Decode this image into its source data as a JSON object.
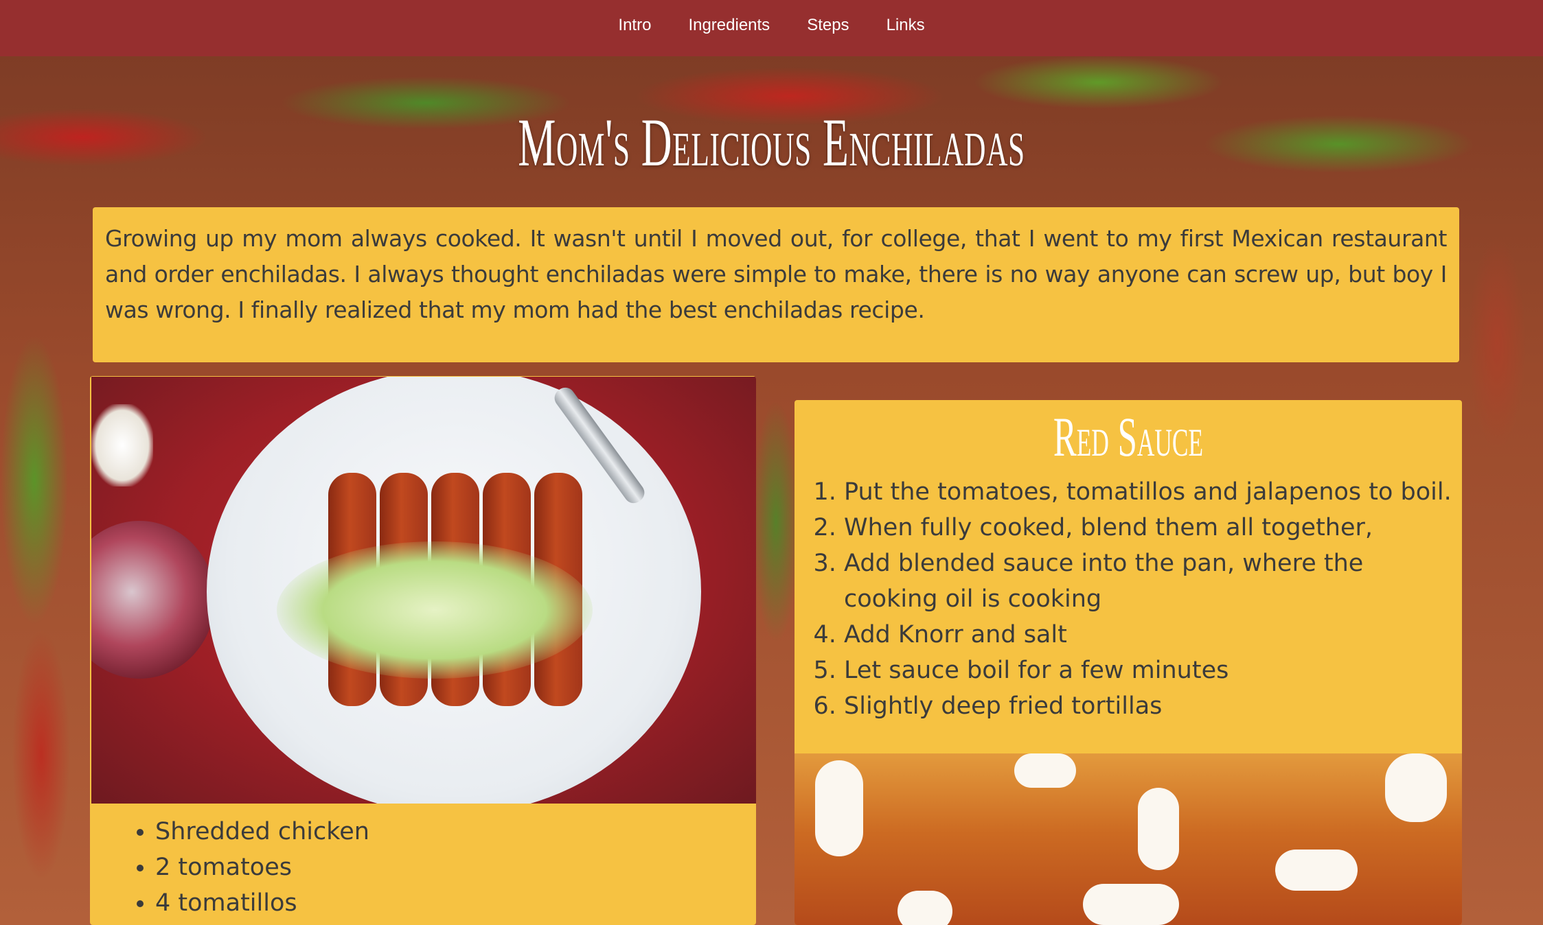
{
  "nav": {
    "items": [
      {
        "label": "Intro"
      },
      {
        "label": "Ingredients"
      },
      {
        "label": "Steps"
      },
      {
        "label": "Links"
      }
    ]
  },
  "page": {
    "title": "Mom's Delicious Enchiladas"
  },
  "intro": {
    "text": "Growing up my mom always cooked. It wasn't until I moved out, for college, that I went to my first Mexican restaurant and order enchiladas. I always thought enchiladas were simple to make, there is no way anyone can screw up, but boy I was wrong. I finally realized that my mom had the best enchiladas recipe."
  },
  "ingredients": {
    "items": [
      "Shredded chicken",
      "2 tomatoes",
      "4 tomatillos"
    ]
  },
  "red_sauce": {
    "title": "Red Sauce",
    "steps": [
      "Put the tomatoes, tomatillos and jalapenos to boil.",
      "When fully cooked, blend them all together,",
      "Add blended sauce into the pan, where the cooking oil is cooking",
      "Add Knorr and salt",
      "Let sauce boil for a few minutes",
      "Slightly deep fried tortillas"
    ]
  },
  "colors": {
    "nav_bg": "#962f2f",
    "card_bg": "#f6c242",
    "text": "#3b3b3b"
  }
}
